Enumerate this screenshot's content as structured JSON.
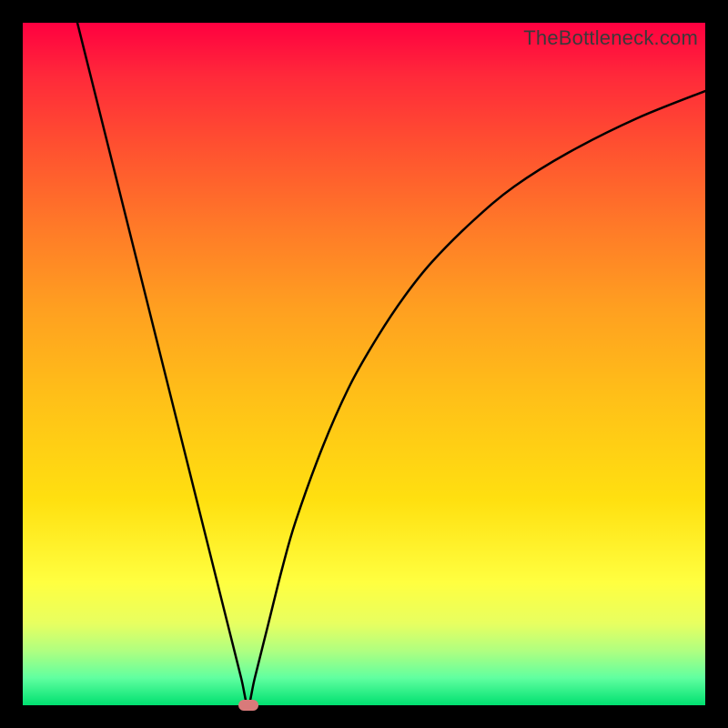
{
  "watermark": "TheBottleneck.com",
  "chart_data": {
    "type": "line",
    "title": "",
    "xlabel": "",
    "ylabel": "",
    "xlim": [
      0,
      100
    ],
    "ylim": [
      0,
      100
    ],
    "series": [
      {
        "name": "curve",
        "x": [
          8,
          10,
          12,
          14,
          16,
          18,
          20,
          22,
          24,
          26,
          28,
          30,
          32,
          33,
          34,
          36,
          38,
          40,
          44,
          48,
          52,
          56,
          60,
          66,
          72,
          80,
          90,
          100
        ],
        "y": [
          100,
          92,
          84,
          76,
          68,
          60,
          52,
          44,
          36,
          28,
          20,
          12,
          4,
          0,
          4,
          12,
          20,
          27,
          38,
          47,
          54,
          60,
          65,
          71,
          76,
          81,
          86,
          90
        ]
      }
    ],
    "marker": {
      "x": 33,
      "y": 0
    },
    "gradient_stops": [
      {
        "pct": 0,
        "color": "#ff0040"
      },
      {
        "pct": 50,
        "color": "#ffc018"
      },
      {
        "pct": 82,
        "color": "#ffff40"
      },
      {
        "pct": 100,
        "color": "#00e070"
      }
    ]
  }
}
